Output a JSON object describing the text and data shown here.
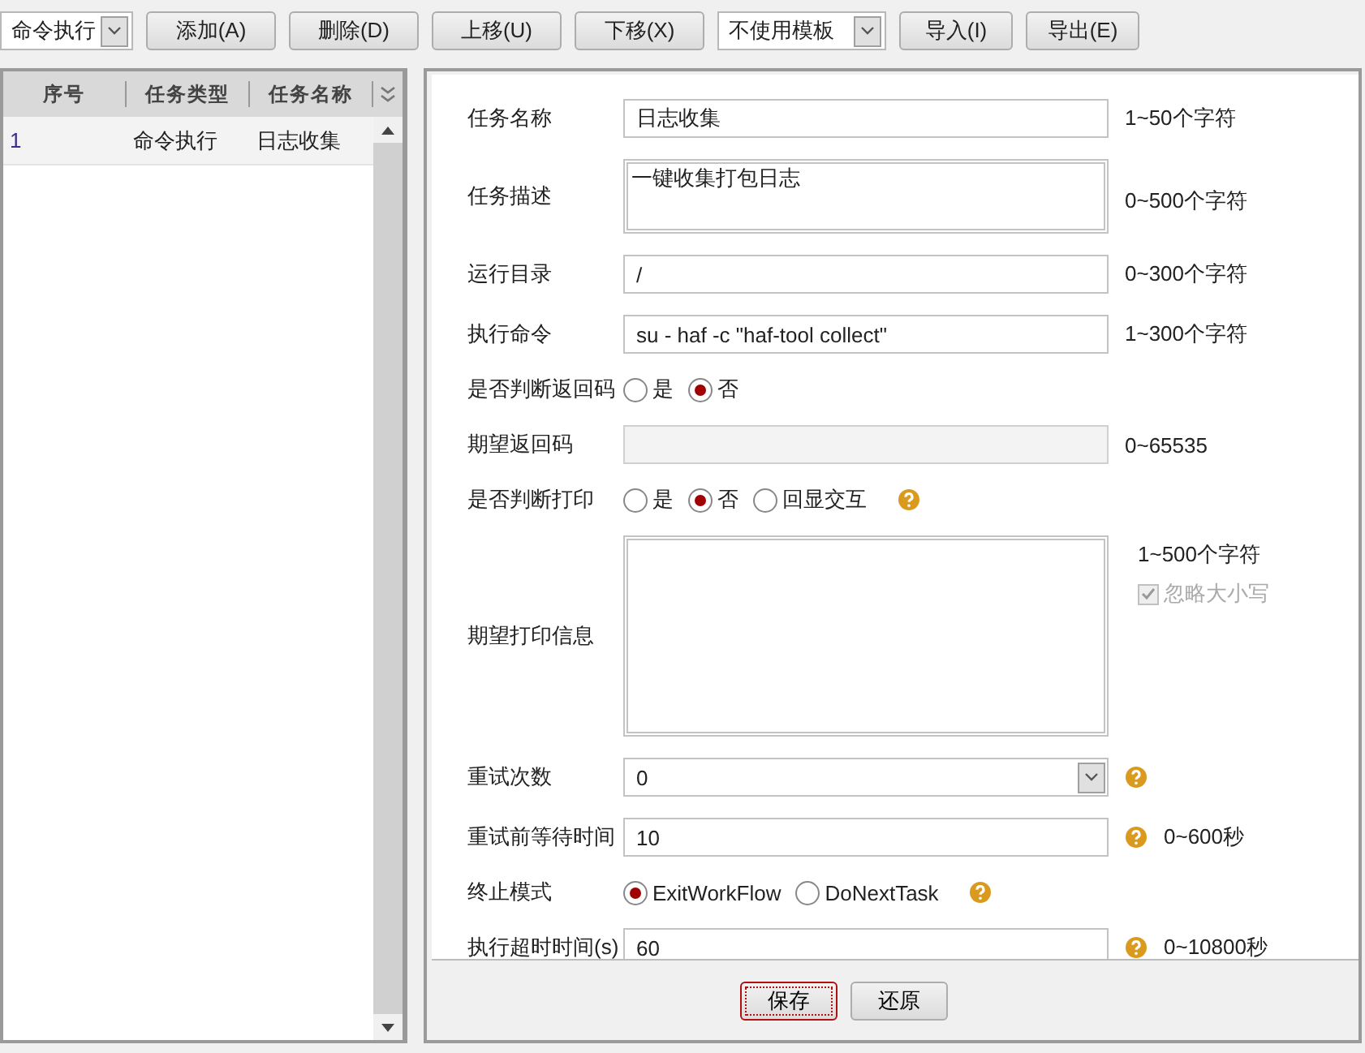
{
  "toolbar": {
    "type_select": "命令执行",
    "buttons": [
      "添加(A)",
      "删除(D)",
      "上移(U)",
      "下移(X)"
    ],
    "template_select": "不使用模板",
    "buttons_right": [
      "导入(I)",
      "导出(E)"
    ]
  },
  "task_table": {
    "columns": [
      "序号",
      "任务类型",
      "任务名称"
    ],
    "rows": [
      {
        "cells": [
          "1",
          "命令执行",
          "日志收集"
        ],
        "selected": true
      }
    ]
  },
  "form": {
    "fields": [
      {
        "kind": "text",
        "label": "任务名称",
        "value": "日志收集",
        "hint": "1~50个字符"
      },
      {
        "kind": "textarea",
        "label": "任务描述",
        "value": "一键收集打包日志",
        "hint": "0~500个字符"
      },
      {
        "kind": "text",
        "label": "运行目录",
        "value": "/",
        "hint": "0~300个字符"
      },
      {
        "kind": "text",
        "label": "执行命令",
        "value": "su - haf -c \"haf-tool collect\"",
        "hint": "1~300个字符"
      },
      {
        "kind": "radio",
        "label": "是否判断返回码",
        "options": [
          {
            "label": "是",
            "selected": false
          },
          {
            "label": "否",
            "selected": true
          }
        ]
      },
      {
        "kind": "text",
        "label": "期望返回码",
        "hint": "0~65535",
        "disabled": true
      },
      {
        "kind": "radio",
        "label": "是否判断打印",
        "options": [
          {
            "label": "是",
            "selected": false
          },
          {
            "label": "否",
            "selected": true
          },
          {
            "label": "回显交互",
            "selected": false
          }
        ],
        "help": true
      },
      {
        "kind": "bigtext",
        "label": "期望打印信息",
        "hint": "1~500个字符",
        "checkbox": {
          "label": "忽略大小写",
          "checked": true,
          "disabled": true
        }
      },
      {
        "kind": "select",
        "label": "重试次数",
        "value": "0",
        "help": true
      },
      {
        "kind": "text",
        "label": "重试前等待时间",
        "value": "10",
        "hint": "0~600秒",
        "help": true
      },
      {
        "kind": "radio",
        "label": "终止模式",
        "options": [
          {
            "label": "ExitWorkFlow",
            "selected": true
          },
          {
            "label": "DoNextTask",
            "selected": false
          }
        ],
        "help": true
      },
      {
        "kind": "text",
        "label": "执行超时时间(s)",
        "value": "60",
        "hint": "0~10800秒",
        "help": true
      }
    ]
  },
  "footer": {
    "buttons": [
      {
        "label": "保存",
        "focused": true
      },
      {
        "label": "还原",
        "focused": false
      }
    ]
  }
}
